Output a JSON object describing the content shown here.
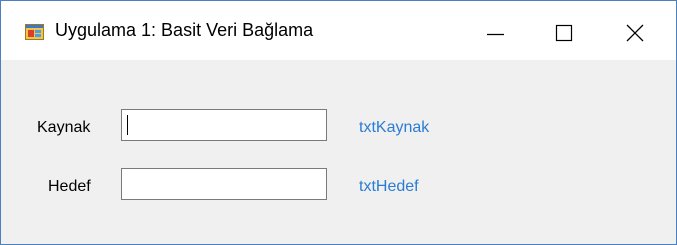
{
  "window": {
    "title": "Uygulama 1: Basit Veri Bağlama",
    "icon": "winforms-app-icon",
    "controls": [
      "minimize-icon",
      "maximize-icon",
      "close-icon"
    ]
  },
  "form": {
    "kaynak": {
      "label": "Kaynak",
      "value": "",
      "control_name": "txtKaynak"
    },
    "hedef": {
      "label": "Hedef",
      "value": "",
      "control_name": "txtHedef"
    }
  },
  "colors": {
    "window_border": "#4a7fc0",
    "client_background": "#f0f0f0",
    "hint_text": "#2b7cd3"
  }
}
